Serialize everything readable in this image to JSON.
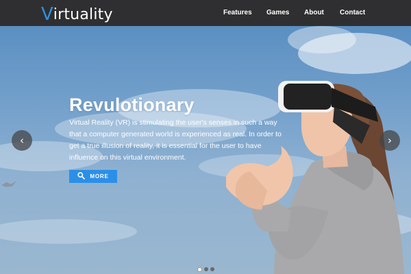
{
  "header": {
    "logo_first": "V",
    "logo_rest": "irtuality",
    "nav": [
      {
        "label": "Features"
      },
      {
        "label": "Games"
      },
      {
        "label": "About"
      },
      {
        "label": "Contact"
      }
    ]
  },
  "hero": {
    "title": "Revulotionary",
    "text": "Virtual Reality (VR) is stimulating the user's senses in such a way that a computer generated world is experienced as real. In order to get a true illusion of reality, it is essential for the user to have influence on this virtual environment.",
    "button_label": "MORE",
    "button_icon": "search-icon",
    "prev_arrow": "‹",
    "next_arrow": "›",
    "slides_total": 3,
    "slide_active": 1
  },
  "colors": {
    "topbar": "#2f2f31",
    "accent": "#2b8fe8",
    "sky": "#76a2cc"
  }
}
